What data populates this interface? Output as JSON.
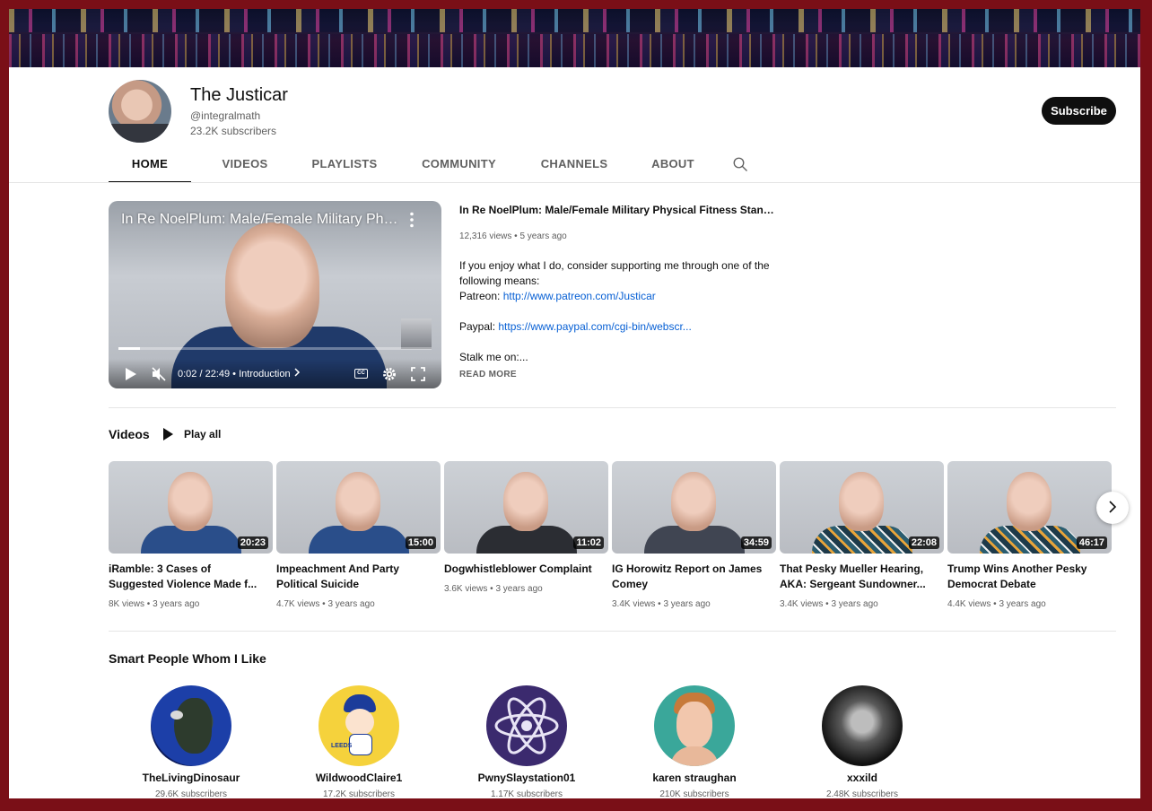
{
  "channel": {
    "name": "The Justicar",
    "handle": "@integralmath",
    "subscribers": "23.2K subscribers",
    "subscribe_label": "Subscribe"
  },
  "tabs": [
    "HOME",
    "VIDEOS",
    "PLAYLISTS",
    "COMMUNITY",
    "CHANNELS",
    "ABOUT"
  ],
  "active_tab": "HOME",
  "featured": {
    "player_title": "In Re NoelPlum: Male/Female Military Phy...",
    "title": "In Re NoelPlum: Male/Female Military Physical Fitness Standa...",
    "views": "12,316 views",
    "age": "5 years ago",
    "desc_line1": "If you enjoy what I do, consider supporting me through one of the following means:",
    "patreon_label": "Patreon: ",
    "patreon_url": "http://www.patreon.com/Justicar",
    "paypal_label": "Paypal: ",
    "paypal_url": "https://www.paypal.com/cgi-bin/webscr...",
    "stalk": "Stalk me on:...",
    "read_more": "READ MORE",
    "timecode": "0:02 / 22:49",
    "chapter": "Introduction",
    "cc_label": "CC",
    "progress": 0.07
  },
  "videos_section": {
    "title": "Videos",
    "play_all": "Play all",
    "items": [
      {
        "title": "iRamble: 3 Cases of Suggested Violence Made f...",
        "duration": "20:23",
        "views": "8K views",
        "age": "3 years ago"
      },
      {
        "title": "Impeachment And Party Political Suicide",
        "duration": "15:00",
        "views": "4.7K views",
        "age": "3 years ago"
      },
      {
        "title": "Dogwhistleblower Complaint",
        "duration": "11:02",
        "views": "3.6K views",
        "age": "3 years ago"
      },
      {
        "title": "IG Horowitz Report on James Comey",
        "duration": "34:59",
        "views": "3.4K views",
        "age": "3 years ago"
      },
      {
        "title": "That Pesky Mueller Hearing, AKA: Sergeant Sundowner...",
        "duration": "22:08",
        "views": "3.4K views",
        "age": "3 years ago"
      },
      {
        "title": "Trump Wins Another Pesky Democrat Debate",
        "duration": "46:17",
        "views": "4.4K views",
        "age": "3 years ago"
      }
    ]
  },
  "channels_section": {
    "title": "Smart People Whom I Like",
    "items": [
      {
        "name": "TheLivingDinosaur",
        "subscribers": "29.6K subscribers"
      },
      {
        "name": "WildwoodClaire1",
        "subscribers": "17.2K subscribers"
      },
      {
        "name": "PwnySlaystation01",
        "subscribers": "1.17K subscribers"
      },
      {
        "name": "karen straughan",
        "subscribers": "210K subscribers"
      },
      {
        "name": "xxxild",
        "subscribers": "2.48K subscribers"
      }
    ]
  },
  "avatar_badge": "LEEDS",
  "meta_separator": "•"
}
